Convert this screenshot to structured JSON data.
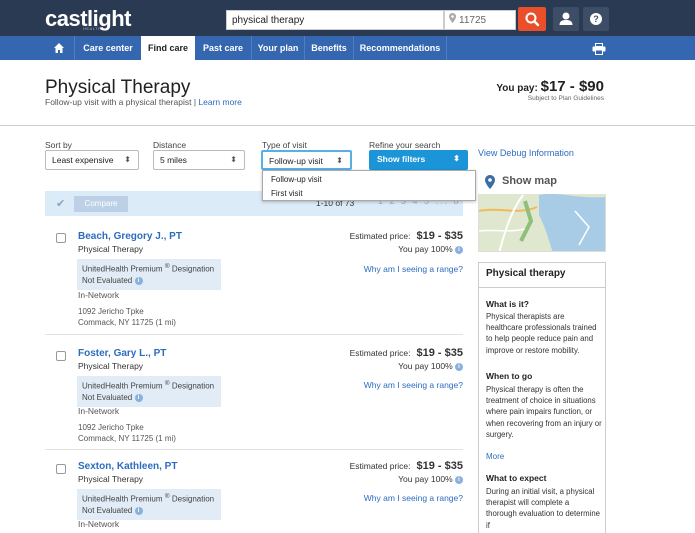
{
  "header": {
    "logo": "castlight",
    "logo_sub": "HEALTH",
    "search_value": "physical therapy",
    "zip_value": "11725"
  },
  "nav": {
    "items": [
      {
        "label": "Care center"
      },
      {
        "label": "Find care",
        "active": true
      },
      {
        "label": "Past care"
      },
      {
        "label": "Your plan"
      },
      {
        "label": "Benefits"
      },
      {
        "label": "Recommendations"
      }
    ]
  },
  "page": {
    "title": "Physical Therapy",
    "subtitle": "Follow-up visit with a physical therapist",
    "learn_more": "Learn more",
    "you_pay_label": "You pay:",
    "you_pay_amount": "$17 - $90",
    "plan_guidelines": "Subject to Plan Guidelines"
  },
  "filters": {
    "sort_label": "Sort by",
    "sort_value": "Least expensive",
    "distance_label": "Distance",
    "distance_value": "5 miles",
    "visit_label": "Type of visit",
    "visit_value": "Follow-up visit",
    "refine_label": "Refine your search",
    "filters_button": "Show filters",
    "visit_options": [
      "Follow-up visit",
      "First visit"
    ],
    "debug_link": "View Debug Information"
  },
  "results": {
    "compare": "Compare",
    "count": "1-10 of 73",
    "pages": "1 2 3 4 5 ... 8"
  },
  "providers": [
    {
      "name": "Beach, Gregory J., PT",
      "specialty": "Physical Therapy",
      "premium": "UnitedHealth Premium",
      "premium_sup": "®",
      "premium_suffix": "Designation",
      "evaluated": "Not Evaluated",
      "network": "In-Network",
      "addr1": "1092 Jericho Tpke",
      "addr2": "Commack, NY 11725 (1 mi)",
      "est_label": "Estimated price:",
      "est_range": "$19 - $35",
      "you_pay": "You pay 100%",
      "why": "Why am I seeing a range?"
    },
    {
      "name": "Foster, Gary L., PT",
      "specialty": "Physical Therapy",
      "premium": "UnitedHealth Premium",
      "premium_sup": "®",
      "premium_suffix": "Designation",
      "evaluated": "Not Evaluated",
      "network": "In-Network",
      "addr1": "1092 Jericho Tpke",
      "addr2": "Commack, NY 11725 (1 mi)",
      "est_label": "Estimated price:",
      "est_range": "$19 - $35",
      "you_pay": "You pay 100%",
      "why": "Why am I seeing a range?"
    },
    {
      "name": "Sexton, Kathleen, PT",
      "specialty": "Physical Therapy",
      "premium": "UnitedHealth Premium",
      "premium_sup": "®",
      "premium_suffix": "Designation",
      "evaluated": "Not Evaluated",
      "network": "In-Network",
      "addr1": "",
      "addr2": "",
      "est_label": "Estimated price:",
      "est_range": "$19 - $35",
      "you_pay": "You pay 100%",
      "why": "Why am I seeing a range?"
    }
  ],
  "sidebar": {
    "show_map": "Show map",
    "info_title": "Physical therapy",
    "what_heading": "What is it?",
    "what_text": "Physical therapists are healthcare professionals trained to help people reduce pain and improve or restore mobility.",
    "when_heading": "When to go",
    "when_text": "Physical therapy is often the treatment of choice in situations where pain impairs function, or when recovering from an injury or surgery.",
    "more": "More",
    "expect_heading": "What to expect",
    "expect_text": "During an initial visit, a physical therapist will complete a thorough evaluation to determine if"
  },
  "colors": {
    "topbar": "#2a3a52",
    "navbar": "#3566b0",
    "accent_orange": "#e94f2b",
    "link": "#2c6cc0"
  }
}
